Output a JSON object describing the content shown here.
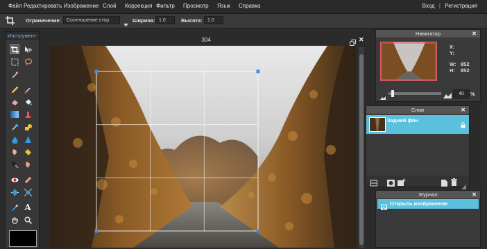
{
  "menu": {
    "items": [
      "Файл",
      "Редактировать",
      "Изображение",
      "Слой",
      "Коррекция",
      "Фильтр",
      "Просмотр",
      "Язык",
      "Справка"
    ],
    "login": "Вход",
    "separator": "|",
    "register": "Регистрация"
  },
  "options": {
    "constraint_label": "Ограничение:",
    "constraint_value": "Соотношение стор",
    "width_label": "Ширина:",
    "width_value": "1.0",
    "height_label": "Высота:",
    "height_value": "1.0"
  },
  "toolbox": {
    "title": "Инструмент"
  },
  "canvas": {
    "title": "304"
  },
  "navigator": {
    "title": "Навигатор",
    "x_label": "X:",
    "y_label": "Y:",
    "w_label": "W:",
    "w_value": "852",
    "h_label": "H:",
    "h_value": "852",
    "zoom_value": "40",
    "zoom_unit": "%"
  },
  "layers": {
    "title": "Слои",
    "items": [
      {
        "name": "Задний фон"
      }
    ]
  },
  "history": {
    "title": "Журнал",
    "items": [
      {
        "label": "Открыть изображение"
      }
    ]
  },
  "colors": {
    "accent": "#5bc0de",
    "primary_color": "#000000",
    "selection_handle": "#3d8fe0"
  }
}
